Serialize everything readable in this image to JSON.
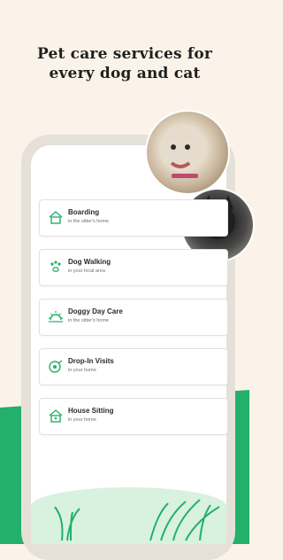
{
  "headline": {
    "line1": "Pet care services for",
    "line2": "every dog and cat"
  },
  "services": [
    {
      "title": "Boarding",
      "subtitle": "in the sitter's home",
      "icon": "house-icon"
    },
    {
      "title": "Dog Walking",
      "subtitle": "in your local area",
      "icon": "paw-icon"
    },
    {
      "title": "Doggy Day Care",
      "subtitle": "in the sitter's home",
      "icon": "sun-icon"
    },
    {
      "title": "Drop-In Visits",
      "subtitle": "in your home",
      "icon": "visit-icon"
    },
    {
      "title": "House Sitting",
      "subtitle": "in your home",
      "icon": "house-sitting-icon"
    }
  ],
  "colors": {
    "accent": "#22b06a",
    "background": "#fbf3ea",
    "light_green": "#d9f1df"
  }
}
